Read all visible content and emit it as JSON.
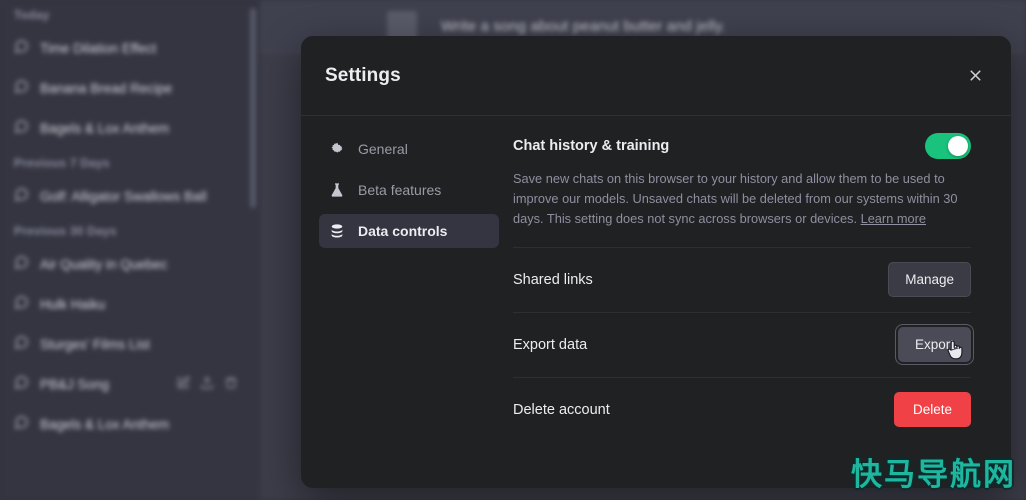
{
  "background": {
    "message": {
      "avatar": "user-avatar",
      "text": "Write a song about peanut butter and jelly."
    },
    "sidebar": {
      "groups": [
        {
          "label": "Today",
          "items": [
            {
              "title": "Time Dilation Effect",
              "icon": "chat-bubble-icon",
              "active": false
            },
            {
              "title": "Banana Bread Recipe",
              "icon": "chat-bubble-icon",
              "active": false
            },
            {
              "title": "Bagels & Lox Anthem",
              "icon": "chat-bubble-icon",
              "active": false
            }
          ]
        },
        {
          "label": "Previous 7 Days",
          "items": [
            {
              "title": "Golf: Alligator Swallows Ball",
              "icon": "chat-bubble-icon",
              "active": false
            }
          ]
        },
        {
          "label": "Previous 30 Days",
          "items": [
            {
              "title": "Air Quality in Quebec",
              "icon": "chat-bubble-icon",
              "active": false
            },
            {
              "title": "Hulk Haiku",
              "icon": "chat-bubble-icon",
              "active": false
            },
            {
              "title": "Sturges' Films List",
              "icon": "chat-bubble-icon",
              "active": false
            },
            {
              "title": "PB&J Song",
              "icon": "chat-bubble-icon",
              "active": true,
              "actions": [
                "edit-icon",
                "share-icon",
                "trash-icon"
              ]
            },
            {
              "title": "Bagels & Lox Anthem",
              "icon": "chat-bubble-icon",
              "active": false
            }
          ]
        }
      ]
    }
  },
  "modal": {
    "title": "Settings",
    "close_icon": "close-icon",
    "nav": [
      {
        "label": "General",
        "icon": "gear-icon",
        "active": false
      },
      {
        "label": "Beta features",
        "icon": "flask-icon",
        "active": false
      },
      {
        "label": "Data controls",
        "icon": "database-icon",
        "active": true
      }
    ],
    "sections": {
      "chat_history": {
        "title": "Chat history & training",
        "description": "Save new chats on this browser to your history and allow them to be used to improve our models. Unsaved chats will be deleted from our systems within 30 days. This setting does not sync across browsers or devices.",
        "learn_more": "Learn more",
        "toggle_state": "on",
        "toggle_color": "#19c37d"
      },
      "shared_links": {
        "label": "Shared links",
        "button": "Manage"
      },
      "export_data": {
        "label": "Export data",
        "button": "Export",
        "button_state": "hovered"
      },
      "delete_account": {
        "label": "Delete account",
        "button": "Delete",
        "button_color": "#ef4146"
      }
    }
  },
  "watermark": {
    "text": "快马导航网"
  },
  "cursor": {
    "type": "pointer-hand-cursor"
  }
}
